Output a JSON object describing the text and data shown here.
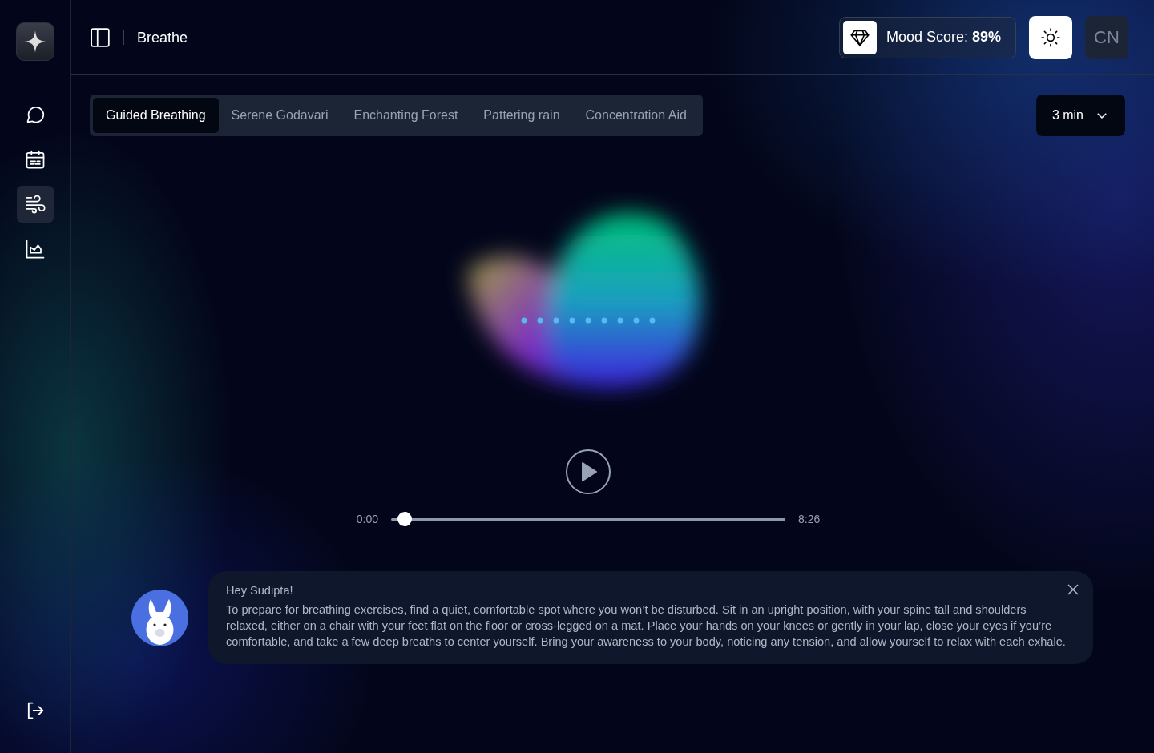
{
  "sidebar": {
    "items": [
      {
        "kind": "chat",
        "selected": false
      },
      {
        "kind": "calendar",
        "selected": false
      },
      {
        "kind": "breathe",
        "selected": true
      },
      {
        "kind": "chart",
        "selected": false
      }
    ]
  },
  "header": {
    "title": "Breathe",
    "mood_label": "Mood Score: ",
    "mood_value": "89%",
    "avatar_initials": "CN"
  },
  "tabs": [
    {
      "label": "Guided Breathing",
      "selected": true
    },
    {
      "label": "Serene Godavari",
      "selected": false
    },
    {
      "label": "Enchanting Forest",
      "selected": false
    },
    {
      "label": "Pattering rain",
      "selected": false
    },
    {
      "label": "Concentration Aid",
      "selected": false
    }
  ],
  "duration": "3 min",
  "player": {
    "current": "0:00",
    "total": "8:26",
    "level": 0.035
  },
  "message": {
    "greeting": "Hey Sudipta!",
    "text": "To prepare for breathing exercises, find a quiet, comfortable spot where you won’t be disturbed. Sit in an upright position, with your spine tall and shoulders relaxed, either on a chair with your feet flat on the floor or cross-legged on a mat. Place your hands on your knees or gently in your lap, close your eyes if you’re comfortable, and take a few deep breaths to center yourself. Bring your awareness to your body, noticing any tension, and allow yourself to relax with each exhale."
  }
}
